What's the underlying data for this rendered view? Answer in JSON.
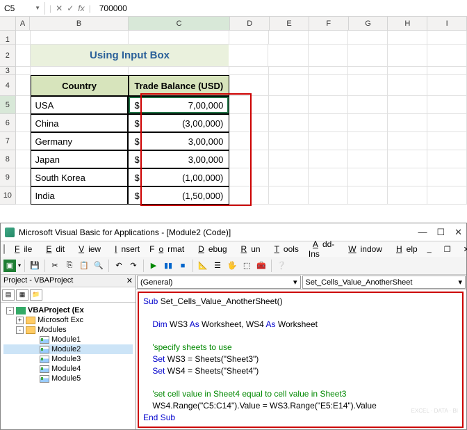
{
  "formula_bar": {
    "name_box": "C5",
    "fx_x": "✕",
    "fx_check": "✓",
    "fx_label": "fx",
    "formula": "700000"
  },
  "columns": [
    "A",
    "B",
    "C",
    "D",
    "E",
    "F",
    "G",
    "H",
    "I"
  ],
  "rows": [
    "1",
    "2",
    "3",
    "4",
    "5",
    "6",
    "7",
    "8",
    "9",
    "10"
  ],
  "title": "Using Input Box",
  "headers": {
    "country": "Country",
    "balance": "Trade Balance (USD)"
  },
  "data": [
    {
      "country": "USA",
      "cur": "$",
      "balance": "7,00,000"
    },
    {
      "country": "China",
      "cur": "$",
      "balance": "(3,00,000)"
    },
    {
      "country": "Germany",
      "cur": "$",
      "balance": "3,00,000"
    },
    {
      "country": "Japan",
      "cur": "$",
      "balance": "3,00,000"
    },
    {
      "country": "South Korea",
      "cur": "$",
      "balance": "(1,00,000)"
    },
    {
      "country": "India",
      "cur": "$",
      "balance": "(1,50,000)"
    }
  ],
  "vba": {
    "title": "Microsoft Visual Basic for Applications - [Module2 (Code)]",
    "menu": [
      "File",
      "Edit",
      "View",
      "Insert",
      "Format",
      "Debug",
      "Run",
      "Tools",
      "Add-Ins",
      "Window",
      "Help"
    ],
    "project_title": "Project - VBAProject",
    "tree": {
      "project": "VBAProject (Ex",
      "msexcel": "Microsoft Exc",
      "modules": "Modules",
      "mods": [
        "Module1",
        "Module2",
        "Module3",
        "Module4",
        "Module5"
      ]
    },
    "dd_left": "(General)",
    "dd_right": "Set_Cells_Value_AnotherSheet",
    "code": {
      "l1a": "Sub ",
      "l1b": "Set_Cells_Value_AnotherSheet()",
      "l3a": "    Dim ",
      "l3b": "WS3 ",
      "l3c": "As ",
      "l3d": "Worksheet, WS4 ",
      "l3e": "As ",
      "l3f": "Worksheet",
      "l5": "    'specify sheets to use",
      "l6a": "    Set ",
      "l6b": "WS3 = Sheets(\"Sheet3\")",
      "l7a": "    Set ",
      "l7b": "WS4 = Sheets(\"Sheet4\")",
      "l9": "    'set cell value in Sheet4 equal to cell value in Sheet3",
      "l10": "    WS4.Range(\"C5:C14\").Value = WS3.Range(\"E5:E14\").Value",
      "l11": "End Sub"
    },
    "watermark": "EXCEL · DATA · BI"
  }
}
